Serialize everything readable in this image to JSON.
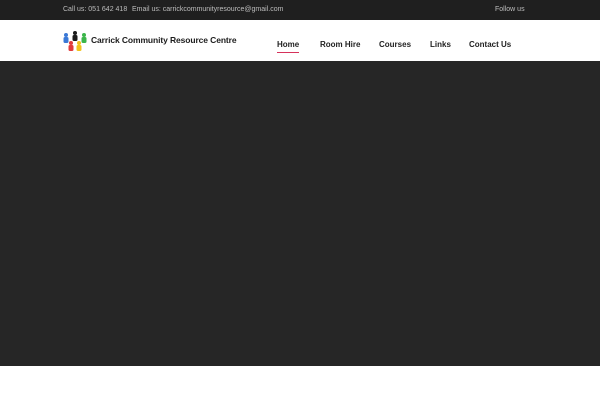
{
  "topbar": {
    "call": "Call us: 051 642 418",
    "email": "Email us: carrickcommunityresource@gmail.com",
    "follow": "Follow us"
  },
  "logo": {
    "text": "Carrick Community Resource Centre",
    "figure_colors": [
      "#3a78d6",
      "#e23b3b",
      "#1a1a1a",
      "#f2c21b",
      "#3bb54a"
    ]
  },
  "nav": {
    "items": [
      {
        "label": "Home",
        "active": true
      },
      {
        "label": "Room Hire"
      },
      {
        "label": "Courses"
      },
      {
        "label": "Links"
      },
      {
        "label": "Contact Us"
      }
    ],
    "accent_color": "#d6325b"
  },
  "colors": {
    "topbar": "#1f1f1f",
    "hero": "#262626"
  }
}
